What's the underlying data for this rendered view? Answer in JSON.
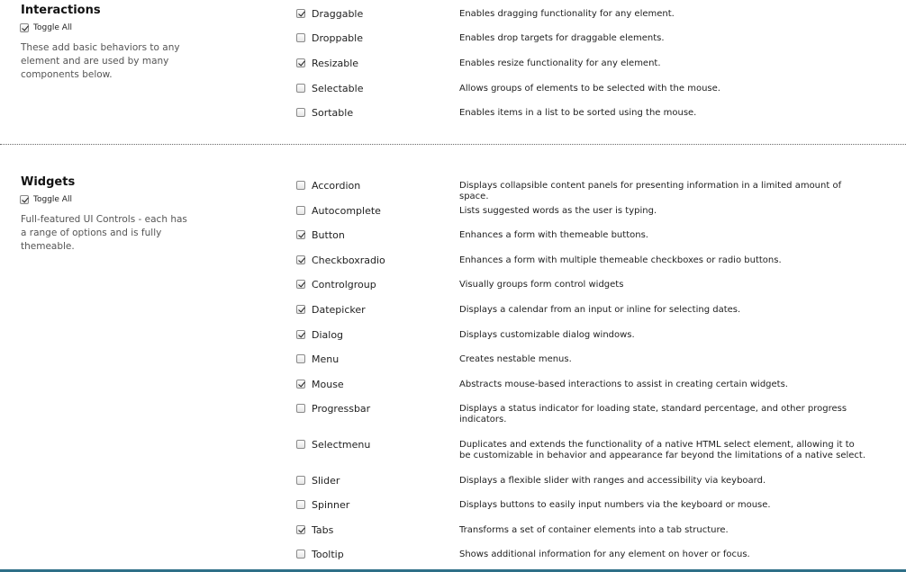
{
  "interactions": {
    "title": "Interactions",
    "toggle_label": "Toggle All",
    "toggle_checked": true,
    "description": "These add basic behaviors to any element and are used by many components below.",
    "items": [
      {
        "name": "Draggable",
        "checked": true,
        "description": "Enables dragging functionality for any element."
      },
      {
        "name": "Droppable",
        "checked": false,
        "description": "Enables drop targets for draggable elements."
      },
      {
        "name": "Resizable",
        "checked": true,
        "description": "Enables resize functionality for any element."
      },
      {
        "name": "Selectable",
        "checked": false,
        "description": "Allows groups of elements to be selected with the mouse."
      },
      {
        "name": "Sortable",
        "checked": false,
        "description": "Enables items in a list to be sorted using the mouse."
      }
    ]
  },
  "widgets": {
    "title": "Widgets",
    "toggle_label": "Toggle All",
    "toggle_checked": true,
    "description": "Full-featured UI Controls - each has a range of options and is fully themeable.",
    "items": [
      {
        "name": "Accordion",
        "checked": false,
        "description": "Displays collapsible content panels for presenting information in a limited amount of space."
      },
      {
        "name": "Autocomplete",
        "checked": false,
        "description": "Lists suggested words as the user is typing."
      },
      {
        "name": "Button",
        "checked": true,
        "description": "Enhances a form with themeable buttons."
      },
      {
        "name": "Checkboxradio",
        "checked": true,
        "description": "Enhances a form with multiple themeable checkboxes or radio buttons."
      },
      {
        "name": "Controlgroup",
        "checked": true,
        "description": "Visually groups form control widgets"
      },
      {
        "name": "Datepicker",
        "checked": true,
        "description": "Displays a calendar from an input or inline for selecting dates."
      },
      {
        "name": "Dialog",
        "checked": true,
        "description": "Displays customizable dialog windows."
      },
      {
        "name": "Menu",
        "checked": false,
        "description": "Creates nestable menus."
      },
      {
        "name": "Mouse",
        "checked": true,
        "description": "Abstracts mouse-based interactions to assist in creating certain widgets."
      },
      {
        "name": "Progressbar",
        "checked": false,
        "description": "Displays a status indicator for loading state, standard percentage, and other progress indicators."
      },
      {
        "name": "Selectmenu",
        "checked": false,
        "description": "Duplicates and extends the functionality of a native HTML select element, allowing it to be customizable in behavior and appearance far beyond the limitations of a native select."
      },
      {
        "name": "Slider",
        "checked": false,
        "description": "Displays a flexible slider with ranges and accessibility via keyboard."
      },
      {
        "name": "Spinner",
        "checked": false,
        "description": "Displays buttons to easily input numbers via the keyboard or mouse."
      },
      {
        "name": "Tabs",
        "checked": true,
        "description": "Transforms a set of container elements into a tab structure."
      },
      {
        "name": "Tooltip",
        "checked": false,
        "description": "Shows additional information for any element on hover or focus."
      }
    ]
  }
}
